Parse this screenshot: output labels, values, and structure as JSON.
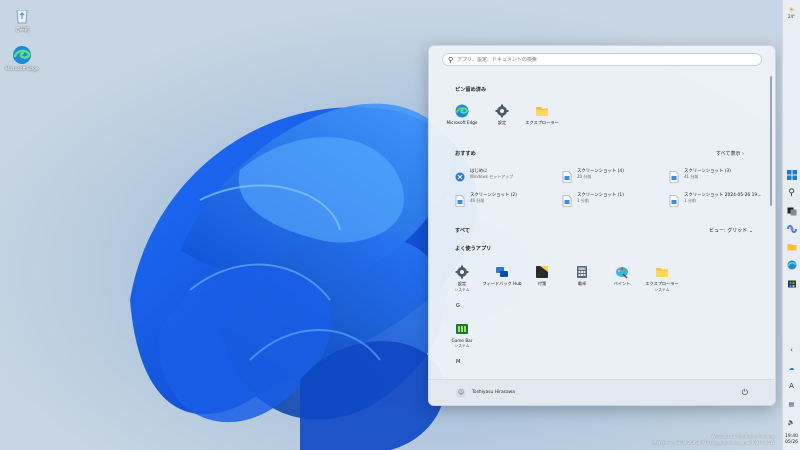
{
  "desktop": {
    "icons": [
      {
        "label": "ごみ箱",
        "icon": "recycle-bin-icon"
      },
      {
        "label": "Microsoft Edge",
        "icon": "edge-icon"
      }
    ],
    "watermark_line1": "Windows 11 Pro Insider Preview",
    "watermark_line2": "評価コピー。Build 26058.0467.ge_prerelease_rs.240316-1612"
  },
  "taskbar": {
    "weather": "24°",
    "time": "19:40",
    "date": "05/26",
    "icons": [
      "start-icon",
      "search-icon",
      "task-view-icon",
      "copilot-icon",
      "file-explorer-icon",
      "edge-icon",
      "store-icon"
    ]
  },
  "start": {
    "search_placeholder": "アプリ、設定、ドキュメントの検索",
    "pinned_title": "ピン留め済み",
    "pinned": [
      {
        "label": "Microsoft Edge",
        "icon": "edge-icon"
      },
      {
        "label": "設定",
        "icon": "settings-gear-icon"
      },
      {
        "label": "エクスプローラー",
        "icon": "folder-icon"
      }
    ],
    "recommended_title": "おすすめ",
    "recommended_more": "すべて表示",
    "recommended": [
      {
        "name": "はじめに",
        "time": "Windows セットアップ"
      },
      {
        "name": "スクリーンショット (4)",
        "time": "20 分前"
      },
      {
        "name": "スクリーンショット (3)",
        "time": "41 分前"
      },
      {
        "name": "スクリーンショット (2)",
        "time": "46 分前"
      },
      {
        "name": "スクリーンショット (1)",
        "time": "1 分前"
      },
      {
        "name": "スクリーンショット 2024-05-26 19...",
        "time": "1 分前"
      }
    ],
    "all_title": "すべて",
    "view_label": "ビュー: グリッド",
    "frequent_title": "よく使うアプリ",
    "frequent": [
      {
        "label": "設定",
        "sub": "システム",
        "icon": "settings-gear-icon"
      },
      {
        "label": "フィードバック Hub",
        "sub": "",
        "icon": "feedback-hub-icon"
      },
      {
        "label": "付箋",
        "sub": "",
        "icon": "sticky-notes-icon"
      },
      {
        "label": "電卓",
        "sub": "",
        "icon": "calculator-icon"
      },
      {
        "label": "ペイント",
        "sub": "",
        "icon": "paint-icon"
      },
      {
        "label": "エクスプローラー",
        "sub": "システム",
        "icon": "folder-icon"
      }
    ],
    "letter_g": "G",
    "gamebar": {
      "label": "Game Bar",
      "sub": "システム"
    },
    "letter_m": "M",
    "user_name": "Toshiyasu Hirasawa"
  }
}
